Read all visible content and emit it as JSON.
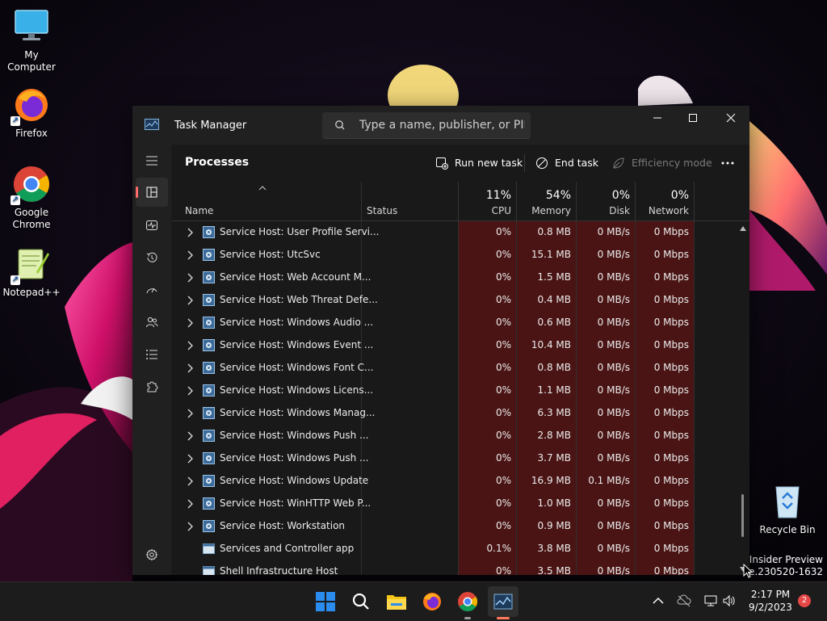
{
  "desktop": {
    "icons": [
      {
        "label": "My Computer"
      },
      {
        "label": "Firefox"
      },
      {
        "label": "Google Chrome"
      },
      {
        "label": "Notepad++"
      }
    ],
    "recycle_bin": {
      "label": "Recycle Bin"
    },
    "watermark": {
      "line1": "o Insider Preview",
      "line2": "ease.230520-1632"
    }
  },
  "task_manager": {
    "title": "Task Manager",
    "search_placeholder": "Type a name, publisher, or PID...",
    "page_heading": "Processes",
    "toolbar": {
      "run_new_task": "Run new task",
      "end_task": "End task",
      "efficiency_mode": "Efficiency mode"
    },
    "columns": {
      "name": "Name",
      "status": "Status",
      "cpu": {
        "pct": "11%",
        "label": "CPU"
      },
      "memory": {
        "pct": "54%",
        "label": "Memory"
      },
      "disk": {
        "pct": "0%",
        "label": "Disk"
      },
      "network": {
        "pct": "0%",
        "label": "Network"
      }
    },
    "rows": [
      {
        "name": "Service Host: User Profile Servi...",
        "expandable": true,
        "cpu": "0%",
        "memory": "0.8 MB",
        "disk": "0 MB/s",
        "network": "0 Mbps"
      },
      {
        "name": "Service Host: UtcSvc",
        "expandable": true,
        "cpu": "0%",
        "memory": "15.1 MB",
        "disk": "0 MB/s",
        "network": "0 Mbps"
      },
      {
        "name": "Service Host: Web Account M...",
        "expandable": true,
        "cpu": "0%",
        "memory": "1.5 MB",
        "disk": "0 MB/s",
        "network": "0 Mbps"
      },
      {
        "name": "Service Host: Web Threat Defe...",
        "expandable": true,
        "cpu": "0%",
        "memory": "0.4 MB",
        "disk": "0 MB/s",
        "network": "0 Mbps"
      },
      {
        "name": "Service Host: Windows Audio ...",
        "expandable": true,
        "cpu": "0%",
        "memory": "0.6 MB",
        "disk": "0 MB/s",
        "network": "0 Mbps"
      },
      {
        "name": "Service Host: Windows Event ...",
        "expandable": true,
        "cpu": "0%",
        "memory": "10.4 MB",
        "disk": "0 MB/s",
        "network": "0 Mbps"
      },
      {
        "name": "Service Host: Windows Font C...",
        "expandable": true,
        "cpu": "0%",
        "memory": "0.8 MB",
        "disk": "0 MB/s",
        "network": "0 Mbps"
      },
      {
        "name": "Service Host: Windows Licens...",
        "expandable": true,
        "cpu": "0%",
        "memory": "1.1 MB",
        "disk": "0 MB/s",
        "network": "0 Mbps"
      },
      {
        "name": "Service Host: Windows Manag...",
        "expandable": true,
        "cpu": "0%",
        "memory": "6.3 MB",
        "disk": "0 MB/s",
        "network": "0 Mbps"
      },
      {
        "name": "Service Host: Windows Push ...",
        "expandable": true,
        "cpu": "0%",
        "memory": "2.8 MB",
        "disk": "0 MB/s",
        "network": "0 Mbps"
      },
      {
        "name": "Service Host: Windows Push ...",
        "expandable": true,
        "cpu": "0%",
        "memory": "3.7 MB",
        "disk": "0 MB/s",
        "network": "0 Mbps"
      },
      {
        "name": "Service Host: Windows Update",
        "expandable": true,
        "cpu": "0%",
        "memory": "16.9 MB",
        "disk": "0.1 MB/s",
        "network": "0 Mbps"
      },
      {
        "name": "Service Host: WinHTTP Web P...",
        "expandable": true,
        "cpu": "0%",
        "memory": "1.0 MB",
        "disk": "0 MB/s",
        "network": "0 Mbps"
      },
      {
        "name": "Service Host: Workstation",
        "expandable": true,
        "cpu": "0%",
        "memory": "0.9 MB",
        "disk": "0 MB/s",
        "network": "0 Mbps"
      },
      {
        "name": "Services and Controller app",
        "expandable": false,
        "cpu": "0.1%",
        "memory": "3.8 MB",
        "disk": "0 MB/s",
        "network": "0 Mbps"
      },
      {
        "name": "Shell Infrastructure Host",
        "expandable": false,
        "cpu": "0%",
        "memory": "3.5 MB",
        "disk": "0 MB/s",
        "network": "0 Mbps"
      }
    ]
  },
  "taskbar": {
    "clock": {
      "time": "2:17 PM",
      "date": "9/2/2023"
    },
    "notification_count": "2"
  }
}
